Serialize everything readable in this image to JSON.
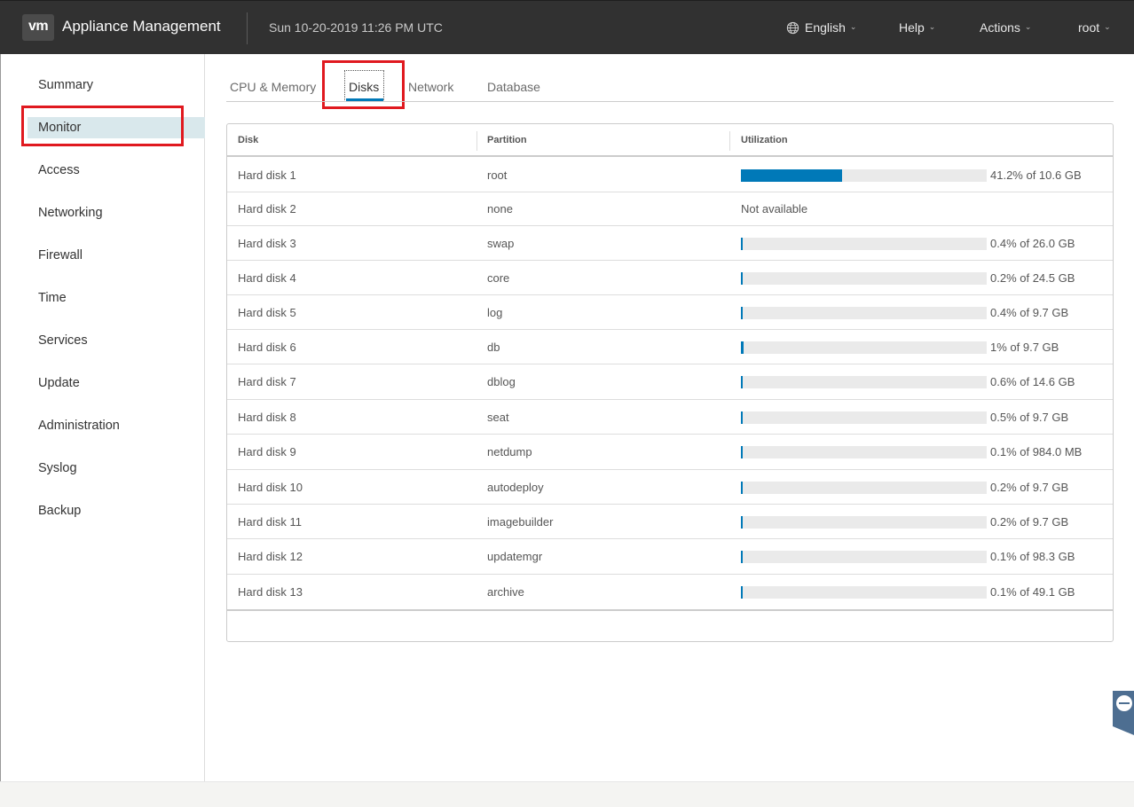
{
  "header": {
    "logo_text": "vm",
    "title": "Appliance Management",
    "datetime": "Sun 10-20-2019 11:26 PM UTC",
    "menus": [
      {
        "label": "English",
        "icon": "globe-icon"
      },
      {
        "label": "Help"
      },
      {
        "label": "Actions"
      },
      {
        "label": "root"
      }
    ]
  },
  "sidebar": {
    "items": [
      {
        "label": "Summary"
      },
      {
        "label": "Monitor",
        "active": true
      },
      {
        "label": "Access"
      },
      {
        "label": "Networking"
      },
      {
        "label": "Firewall"
      },
      {
        "label": "Time"
      },
      {
        "label": "Services"
      },
      {
        "label": "Update"
      },
      {
        "label": "Administration"
      },
      {
        "label": "Syslog"
      },
      {
        "label": "Backup"
      }
    ]
  },
  "tabs": [
    {
      "label": "CPU & Memory"
    },
    {
      "label": "Disks",
      "active": true
    },
    {
      "label": "Network"
    },
    {
      "label": "Database"
    }
  ],
  "grid": {
    "columns": [
      "Disk",
      "Partition",
      "Utilization"
    ],
    "rows": [
      {
        "disk": "Hard disk 1",
        "partition": "root",
        "utilization_text": "41.2% of 10.6 GB",
        "percent": 41.2
      },
      {
        "disk": "Hard disk 2",
        "partition": "none",
        "utilization_text": "Not available",
        "percent": null
      },
      {
        "disk": "Hard disk 3",
        "partition": "swap",
        "utilization_text": "0.4% of 26.0 GB",
        "percent": 0.4
      },
      {
        "disk": "Hard disk 4",
        "partition": "core",
        "utilization_text": "0.2% of 24.5 GB",
        "percent": 0.2
      },
      {
        "disk": "Hard disk 5",
        "partition": "log",
        "utilization_text": "0.4% of 9.7 GB",
        "percent": 0.4
      },
      {
        "disk": "Hard disk 6",
        "partition": "db",
        "utilization_text": "1% of 9.7 GB",
        "percent": 1
      },
      {
        "disk": "Hard disk 7",
        "partition": "dblog",
        "utilization_text": "0.6% of 14.6 GB",
        "percent": 0.6
      },
      {
        "disk": "Hard disk 8",
        "partition": "seat",
        "utilization_text": "0.5% of 9.7 GB",
        "percent": 0.5
      },
      {
        "disk": "Hard disk 9",
        "partition": "netdump",
        "utilization_text": "0.1% of 984.0 MB",
        "percent": 0.1
      },
      {
        "disk": "Hard disk 10",
        "partition": "autodeploy",
        "utilization_text": "0.2% of 9.7 GB",
        "percent": 0.2
      },
      {
        "disk": "Hard disk 11",
        "partition": "imagebuilder",
        "utilization_text": "0.2% of 9.7 GB",
        "percent": 0.2
      },
      {
        "disk": "Hard disk 12",
        "partition": "updatemgr",
        "utilization_text": "0.1% of 98.3 GB",
        "percent": 0.1
      },
      {
        "disk": "Hard disk 13",
        "partition": "archive",
        "utilization_text": "0.1% of 49.1 GB",
        "percent": 0.1
      }
    ]
  },
  "colors": {
    "header_bg": "#313131",
    "accent": "#0079b8",
    "highlight_box": "#e0191f",
    "active_nav_bg": "#d9e8ec"
  }
}
